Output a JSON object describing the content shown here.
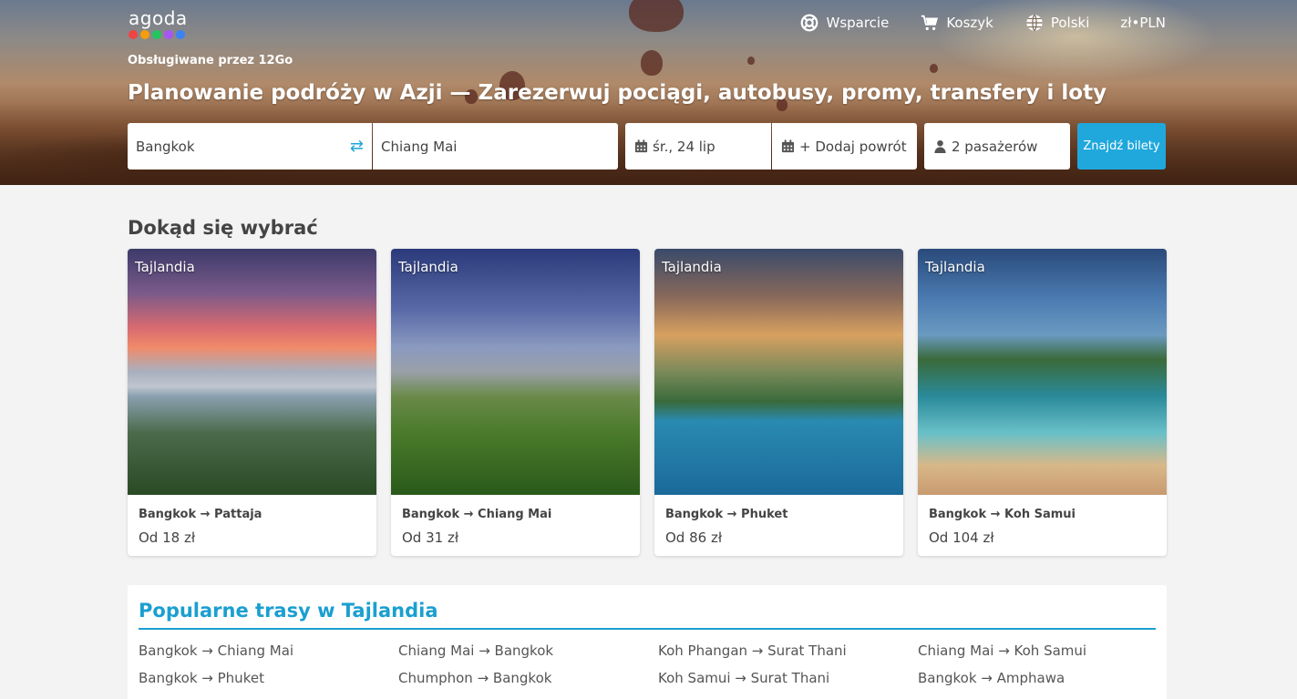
{
  "header": {
    "logo_text": "agoda",
    "logo_colors": [
      "#ef4444",
      "#f59e0b",
      "#22c55e",
      "#a855f7",
      "#3b82f6"
    ],
    "powered_by": "Obsługiwane przez 12Go",
    "nav": [
      {
        "label": "Wsparcie",
        "icon": "lifebuoy-icon"
      },
      {
        "label": "Koszyk",
        "icon": "cart-icon"
      },
      {
        "label": "Polski",
        "icon": "globe-icon"
      },
      {
        "label": "zł•PLN",
        "icon": ""
      }
    ],
    "headline": "Planowanie podróży w Azji — Zarezerwuj pociągi, autobusy, promy, transfery i loty"
  },
  "search": {
    "from": "Bangkok",
    "to": "Chiang Mai",
    "date": "śr., 24 lip",
    "return": "+ Dodaj powrót",
    "passengers": "2 pasażerów",
    "button": "Znajdź bilety",
    "accent": "#20a8dc"
  },
  "destinations": {
    "title": "Dokąd się wybrać",
    "cards": [
      {
        "country": "Tajlandia",
        "route": "Bangkok → Pattaja",
        "price": "Od 18 zł"
      },
      {
        "country": "Tajlandia",
        "route": "Bangkok → Chiang Mai",
        "price": "Od 31 zł"
      },
      {
        "country": "Tajlandia",
        "route": "Bangkok → Phuket",
        "price": "Od 86 zł"
      },
      {
        "country": "Tajlandia",
        "route": "Bangkok → Koh Samui",
        "price": "Od 104 zł"
      }
    ]
  },
  "popular": {
    "title": "Popularne trasy w Tajlandia",
    "routes": [
      "Bangkok → Chiang Mai",
      "Chiang Mai → Bangkok",
      "Koh Phangan → Surat Thani",
      "Chiang Mai → Koh Samui",
      "Bangkok → Phuket",
      "Chumphon → Bangkok",
      "Koh Samui → Surat Thani",
      "Bangkok → Amphawa"
    ]
  }
}
